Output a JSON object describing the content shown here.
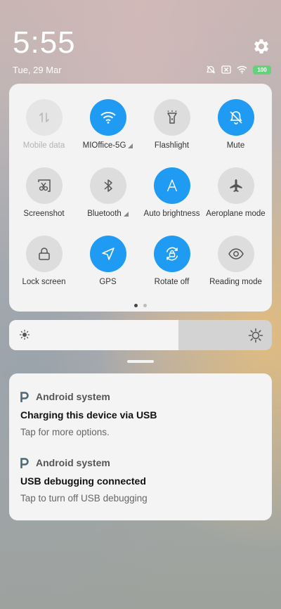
{
  "status_bar": {
    "time": "5:55",
    "date": "Tue, 29 Mar",
    "battery": "100",
    "icons": [
      "alarm-off-icon",
      "no-sim-icon",
      "wifi-icon",
      "battery-icon"
    ]
  },
  "settings_icon": "gear-icon",
  "quick_settings": {
    "tiles": [
      {
        "label": "Mobile data",
        "state": "disabled",
        "icon": "mobile-data-icon"
      },
      {
        "label": "MIOffice-5G",
        "state": "on",
        "icon": "wifi-icon"
      },
      {
        "label": "Flashlight",
        "state": "off",
        "icon": "flashlight-icon"
      },
      {
        "label": "Mute",
        "state": "on",
        "icon": "mute-bell-icon"
      },
      {
        "label": "Screenshot",
        "state": "off",
        "icon": "screenshot-scissors-icon"
      },
      {
        "label": "Bluetooth",
        "state": "off",
        "icon": "bluetooth-icon"
      },
      {
        "label": "Auto brightness",
        "state": "on",
        "icon": "auto-brightness-icon"
      },
      {
        "label": "Aeroplane mode",
        "state": "off",
        "icon": "aeroplane-icon"
      },
      {
        "label": "Lock screen",
        "state": "off",
        "icon": "lock-icon"
      },
      {
        "label": "GPS",
        "state": "on",
        "icon": "gps-arrow-icon"
      },
      {
        "label": "Rotate off",
        "state": "on",
        "icon": "rotate-lock-icon"
      },
      {
        "label": "Reading mode",
        "state": "off",
        "icon": "eye-icon"
      }
    ],
    "page_count": 2,
    "current_page": 1
  },
  "brightness": {
    "level": 0.645,
    "low_icon": "sun-small-icon",
    "high_icon": "sun-large-icon"
  },
  "notifications": [
    {
      "app": "Android system",
      "title": "Charging this device via USB",
      "text": "Tap for more options."
    },
    {
      "app": "Android system",
      "title": "USB debugging connected",
      "text": "Tap to turn off USB debugging"
    }
  ],
  "colors": {
    "accent": "#1f9bf3",
    "battery": "#66d17a"
  }
}
